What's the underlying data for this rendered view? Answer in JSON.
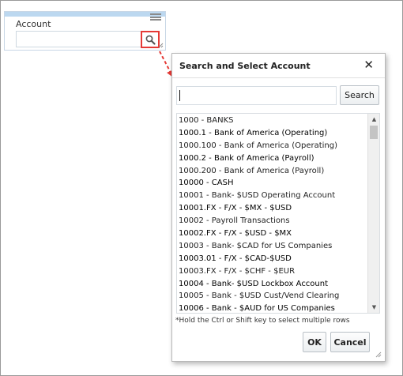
{
  "account_field": {
    "label": "Account",
    "value": "",
    "menu_icon": "hamburger-menu-icon",
    "search_icon": "magnifier-icon"
  },
  "dialog": {
    "title": "Search and Select Account",
    "close_glyph": "✕",
    "search_value": "",
    "search_button": "Search",
    "items": [
      "1000 - BANKS",
      "1000.1 - Bank of America (Operating)",
      "1000.100 - Bank of America (Operating)",
      "1000.2 - Bank of America (Payroll)",
      "1000.200 - Bank of America (Payroll)",
      "10000 - CASH",
      "10001 - Bank- $USD Operating Account",
      "10001.FX - F/X - $MX - $USD",
      "10002 - Payroll Transactions",
      "10002.FX - F/X - $USD - $MX",
      "10003 - Bank- $CAD for US Companies",
      "10003.01 - F/X - $CAD-$USD",
      "10003.FX - F/X - $CHF - $EUR",
      "10004 - Bank- $USD Lockbox Account",
      "10005 - Bank - $USD Cust/Vend Clearing",
      "10006 - Bank - $AUD for US Companies"
    ],
    "hint": "*Hold the Ctrl or Shift key to select multiple rows",
    "ok_button": "OK",
    "cancel_button": "Cancel"
  },
  "colors": {
    "accent_bar": "#bcd8f0",
    "highlight": "#e53935"
  }
}
